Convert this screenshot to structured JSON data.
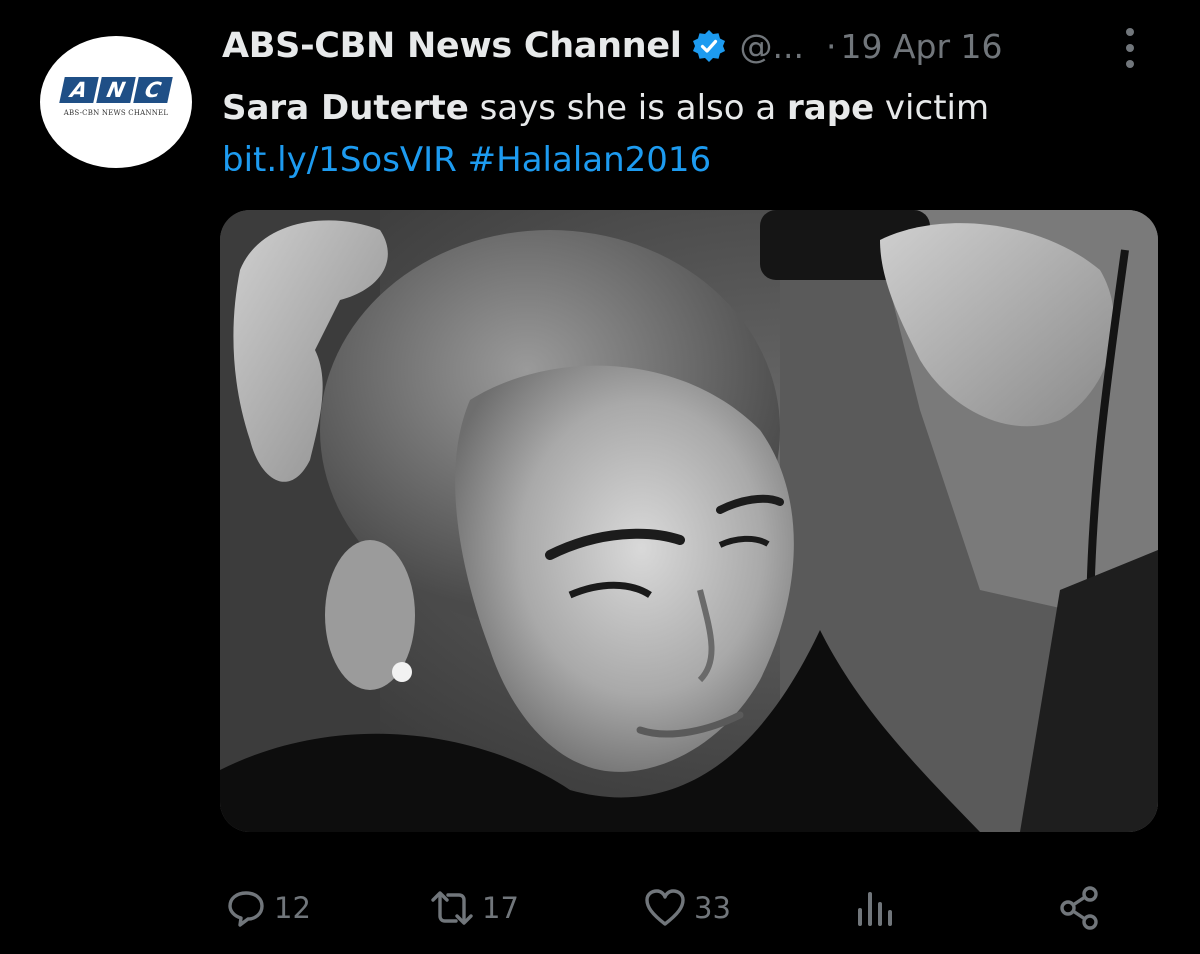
{
  "account": {
    "name": "ABS-CBN News Channel",
    "handle": "@...",
    "separator": "·",
    "date": "19 Apr 16",
    "avatar_logo_letters": [
      "A",
      "N",
      "C"
    ],
    "avatar_logo_sub": "ABS-CBN NEWS CHANNEL"
  },
  "tweet": {
    "name_part": "Sara Duterte",
    "text_part1": " says she is also a ",
    "bold_word": "rape",
    "text_part2": " victim",
    "link": "bit.ly/1SosVIR",
    "hashtag": "#Halalan2016"
  },
  "actions": {
    "replies": "12",
    "retweets": "17",
    "likes": "33"
  },
  "colors": {
    "background": "#000000",
    "text": "#e7e9ea",
    "muted": "#71767b",
    "link": "#1d9bf0",
    "verified": "#1d9bf0",
    "anc_blue": "#1f4f86"
  },
  "icons": {
    "verified": "verified-badge-icon",
    "more": "more-vertical-icon",
    "reply": "reply-icon",
    "retweet": "retweet-icon",
    "like": "heart-icon",
    "views": "analytics-icon",
    "share": "share-icon"
  }
}
